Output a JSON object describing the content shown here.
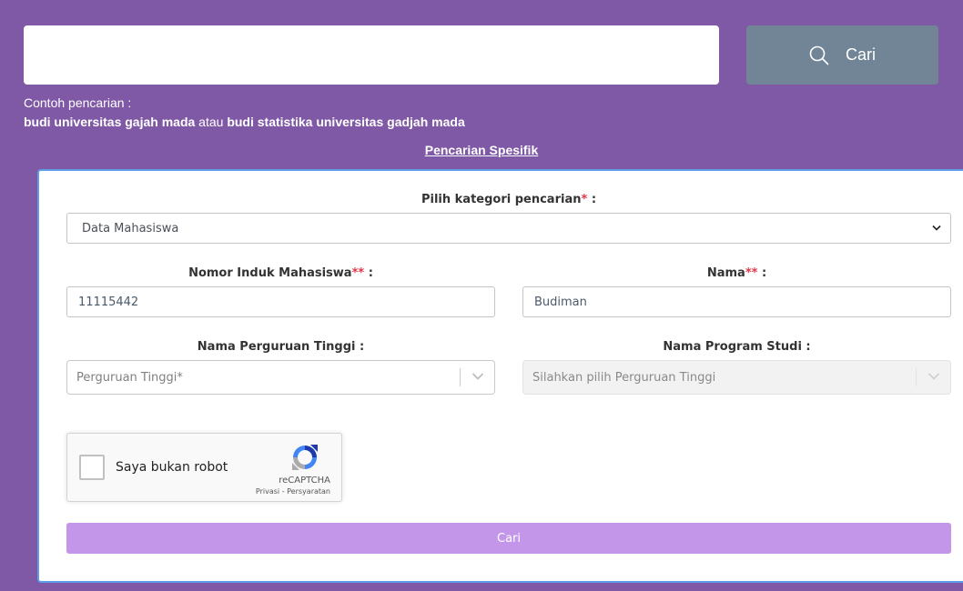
{
  "search": {
    "input_value": "",
    "button_label": "Cari",
    "button_icon": "search-icon"
  },
  "examples": {
    "label": "Contoh pencarian :",
    "example1": "budi universitas gajah mada",
    "connector": "atau",
    "example2": "budi statistika universitas gadjah mada"
  },
  "specific_link": "Pencarian Spesifik",
  "form": {
    "category": {
      "label": "Pilih kategori pencarian",
      "required_mark": "*",
      "suffix": " :",
      "selected": "Data Mahasiswa"
    },
    "nim": {
      "label": "Nomor Induk Mahasiswa",
      "required_mark": "**",
      "suffix": " :",
      "value": "11115442"
    },
    "nama": {
      "label": "Nama",
      "required_mark": "**",
      "suffix": " :",
      "value": "Budiman"
    },
    "perguruan": {
      "label": "Nama Perguruan Tinggi :",
      "placeholder": "Perguruan Tinggi*"
    },
    "prodi": {
      "label": "Nama Program Studi :",
      "placeholder": "Silahkan pilih Perguruan Tinggi"
    },
    "captcha": {
      "label": "Saya bukan robot",
      "brand": "reCAPTCHA",
      "privacy": "Privasi",
      "separator": "-",
      "terms": "Persyaratan"
    },
    "submit_label": "Cari"
  },
  "colors": {
    "background": "#8059a6",
    "search_button": "#718597",
    "card_border": "#5d9ee6",
    "required": "#e0364a",
    "submit": "#c396ea"
  }
}
